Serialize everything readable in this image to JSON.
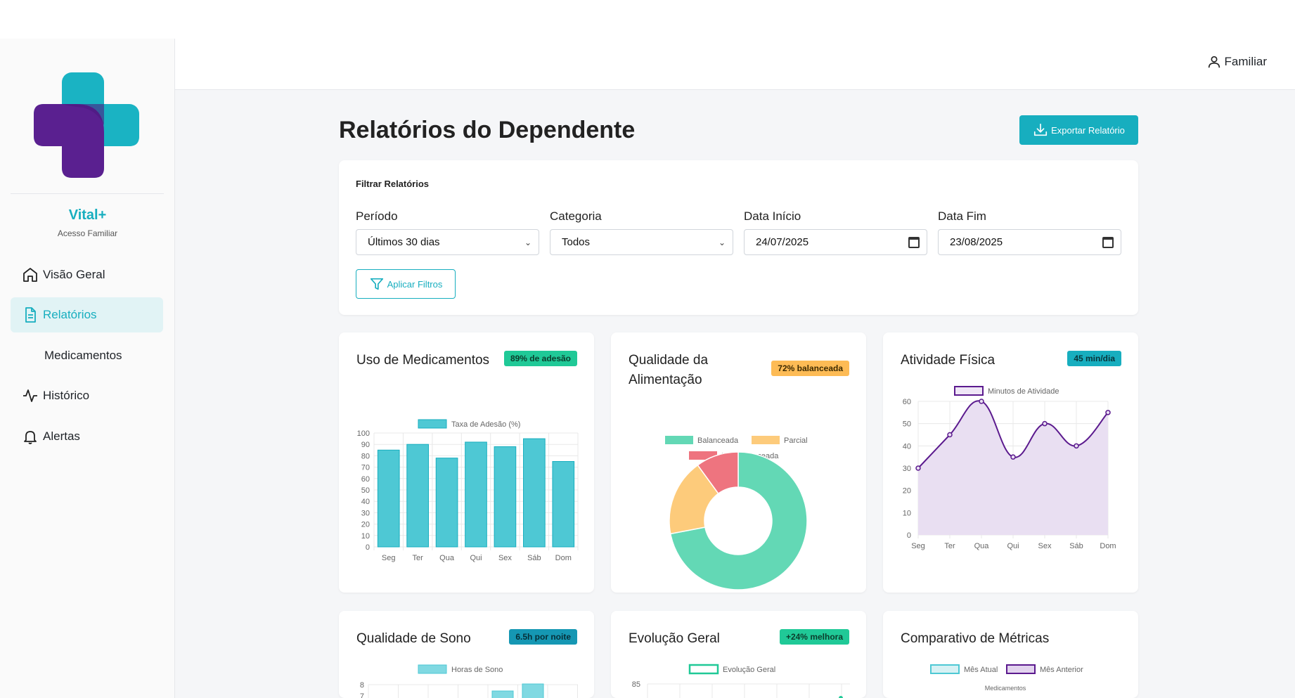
{
  "brand": {
    "name": "Vital+",
    "subtitle": "Acesso Familiar"
  },
  "nav": {
    "items": [
      {
        "label": "Visão Geral",
        "icon": "home-icon"
      },
      {
        "label": "Relatórios",
        "icon": "file-text-icon",
        "active": true
      },
      {
        "label": "Medicamentos"
      },
      {
        "label": "Histórico",
        "icon": "activity-icon"
      },
      {
        "label": "Alertas",
        "icon": "bell-icon"
      }
    ]
  },
  "header": {
    "user_label": "Familiar"
  },
  "page": {
    "title": "Relatórios do Dependente",
    "export_label": "Exportar Relatório"
  },
  "filters": {
    "title": "Filtrar Relatórios",
    "period": {
      "label": "Período",
      "value": "Últimos 30 dias"
    },
    "category": {
      "label": "Categoria",
      "value": "Todos"
    },
    "start": {
      "label": "Data Início",
      "value": "24/07/2025"
    },
    "end": {
      "label": "Data Fim",
      "value": "23/08/2025"
    },
    "apply_label": "Aplicar Filtros"
  },
  "colors": {
    "accent": "#17aebf",
    "purple": "#5b1a8e",
    "green": "#20c997",
    "orange": "#fd9e02",
    "red": "#e0525f"
  },
  "cards": {
    "medication": {
      "title": "Uso de Medicamentos",
      "badge": "89% de adesão"
    },
    "food": {
      "title": "Qualidade da Alimentação",
      "badge": "72% balanceada"
    },
    "activity": {
      "title": "Atividade Física",
      "badge": "45 min/dia"
    },
    "sleep": {
      "title": "Qualidade de Sono",
      "badge": "6.5h por noite"
    },
    "evolution": {
      "title": "Evolução Geral",
      "badge": "+24% melhora"
    },
    "compare": {
      "title": "Comparativo de Métricas"
    }
  },
  "chart_data": [
    {
      "type": "bar",
      "categories": [
        "Seg",
        "Ter",
        "Qua",
        "Qui",
        "Sex",
        "Sáb",
        "Dom"
      ],
      "series": [
        {
          "name": "Taxa de Adesão (%)",
          "values": [
            85,
            90,
            78,
            92,
            88,
            95,
            75
          ]
        }
      ],
      "ylim": [
        0,
        100
      ],
      "yticks": [
        0,
        10,
        20,
        30,
        40,
        50,
        60,
        70,
        80,
        90,
        100
      ],
      "grid": true,
      "legend": "top"
    },
    {
      "type": "pie",
      "labels": [
        "Balanceada",
        "Parcial",
        "Não Balanceada"
      ],
      "values": [
        72,
        18,
        10
      ],
      "donut": true,
      "legend": "top"
    },
    {
      "type": "area",
      "categories": [
        "Seg",
        "Ter",
        "Qua",
        "Qui",
        "Sex",
        "Sáb",
        "Dom"
      ],
      "series": [
        {
          "name": "Minutos de Atividade",
          "values": [
            30,
            45,
            60,
            35,
            50,
            40,
            55
          ]
        }
      ],
      "ylim": [
        0,
        60
      ],
      "yticks": [
        0,
        10,
        20,
        30,
        40,
        50,
        60
      ],
      "grid": true,
      "legend": "top"
    },
    {
      "type": "bar",
      "series": [
        {
          "name": "Horas de Sono"
        }
      ],
      "yticks": [
        7,
        8
      ],
      "legend": "top"
    },
    {
      "type": "line",
      "series": [
        {
          "name": "Evolução Geral"
        }
      ],
      "yticks": [
        85
      ],
      "legend": "top"
    },
    {
      "type": "bar",
      "series": [
        {
          "name": "Mês Atual"
        },
        {
          "name": "Mês Anterior"
        }
      ],
      "categories": [
        "Medicamentos"
      ],
      "legend": "top"
    }
  ]
}
